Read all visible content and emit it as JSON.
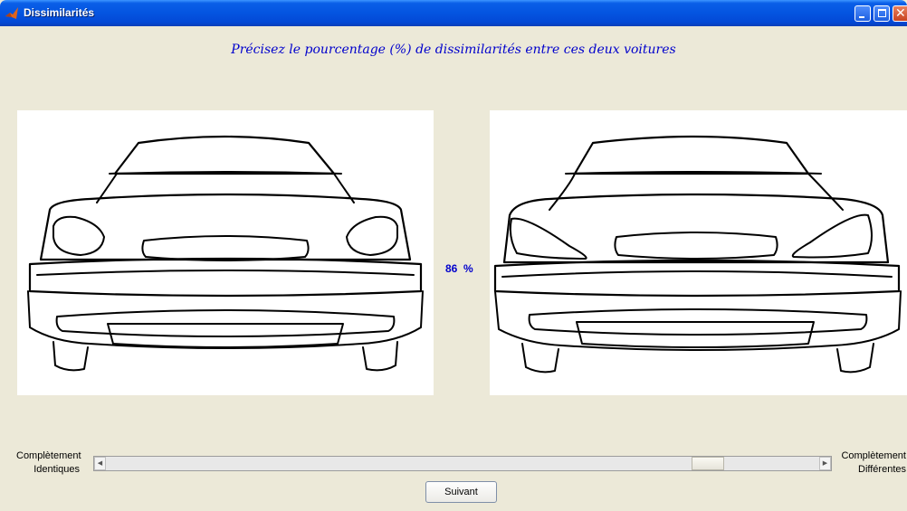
{
  "window": {
    "title": "Dissimilarités",
    "app_icon": "matlab-icon"
  },
  "heading": "Précisez le pourcentage (%) de dissimilarités entre ces deux voitures",
  "percentage": {
    "value": "86",
    "unit": "%"
  },
  "slider": {
    "left_label_line1": "Complètement",
    "left_label_line2": "Identiques",
    "right_label_line1": "Complètement",
    "right_label_line2": "Différentes",
    "value_fraction": 0.86
  },
  "button": {
    "label": "Suivant"
  },
  "images": {
    "left": "car-front-image-a",
    "right": "car-front-image-b"
  }
}
